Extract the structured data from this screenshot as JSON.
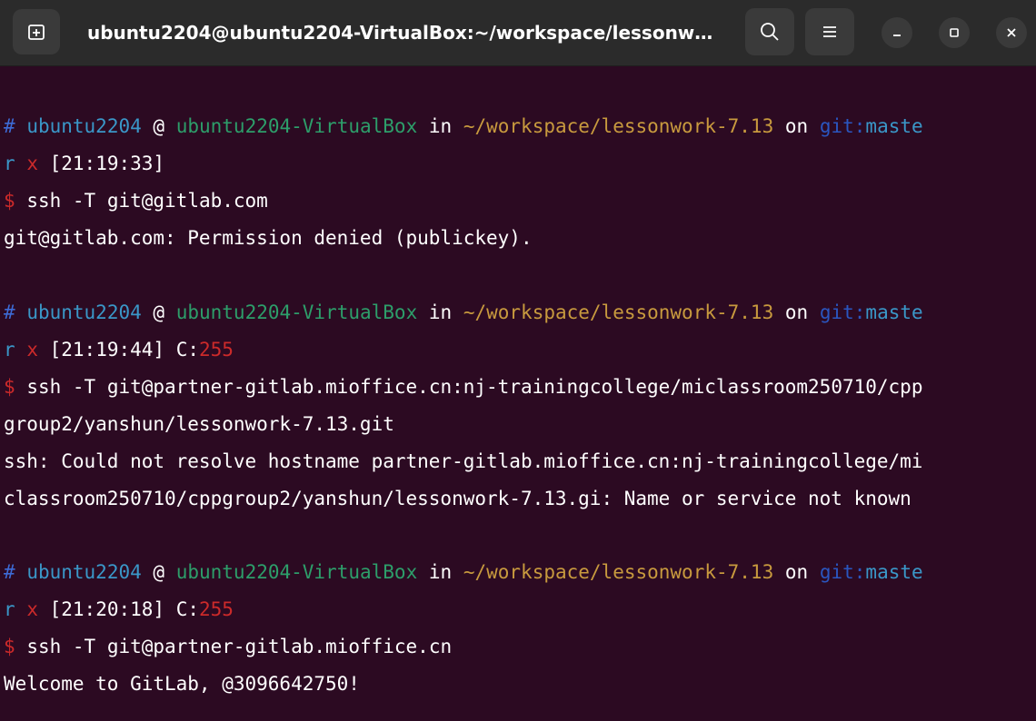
{
  "window": {
    "title": "ubuntu2204@ubuntu2204-VirtualBox:~/workspace/lessonwo..."
  },
  "icons": {
    "new_tab": "new-tab-icon",
    "search": "search-icon",
    "menu": "hamburger-menu-icon",
    "minimize": "minimize-icon",
    "maximize": "maximize-icon",
    "close": "close-icon"
  },
  "colors": {
    "background": "#2c0a22",
    "titlebar": "#2b2b2b",
    "user": "#3a97c8",
    "host": "#2d9e6a",
    "path": "#c89a3e",
    "error": "#cc2a2a"
  },
  "prompt": {
    "hash": "#",
    "user": "ubuntu2204",
    "at": "@",
    "host": "ubuntu2204-VirtualBox",
    "in": "in",
    "path": "~/workspace/lessonwork-7.13",
    "on": "on",
    "git": "git",
    "colon": ":",
    "branch_a": "maste",
    "branch_b": "r",
    "dirty": "x",
    "dollar": "$",
    "exit_label": "C:"
  },
  "blocks": [
    {
      "time": "[21:19:33]",
      "exit_code": "",
      "command": "ssh -T git@gitlab.com",
      "output": [
        "git@gitlab.com: Permission denied (publickey)."
      ]
    },
    {
      "time": "[21:19:44]",
      "exit_code": "255",
      "command": "ssh -T git@partner-gitlab.mioffice.cn:nj-trainingcollege/miclassroom250710/cpp",
      "command_cont": "group2/yanshun/lessonwork-7.13.git",
      "output": [
        "ssh: Could not resolve hostname partner-gitlab.mioffice.cn:nj-trainingcollege/mi",
        "classroom250710/cppgroup2/yanshun/lessonwork-7.13.gi: Name or service not known"
      ]
    },
    {
      "time": "[21:20:18]",
      "exit_code": "255",
      "command": "ssh -T git@partner-gitlab.mioffice.cn",
      "output": [
        "Welcome to GitLab, @3096642750!"
      ]
    }
  ]
}
